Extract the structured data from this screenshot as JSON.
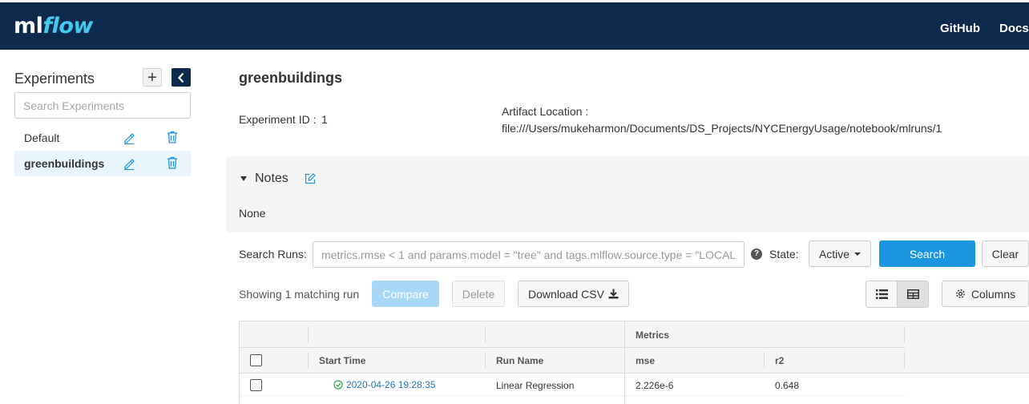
{
  "header": {
    "logo_ml": "ml",
    "logo_flow": "flow",
    "nav": [
      "GitHub",
      "Docs"
    ],
    "background": "#0d2a4d"
  },
  "sidebar": {
    "title": "Experiments",
    "add_label": "+",
    "search_placeholder": "Search Experiments",
    "experiments": [
      {
        "name": "Default",
        "active": false
      },
      {
        "name": "greenbuildings",
        "active": true
      }
    ]
  },
  "experiment": {
    "title": "greenbuildings",
    "id_label": "Experiment ID :",
    "id_value": "1",
    "artifact_label": "Artifact Location :",
    "artifact_value": "file:///Users/mukeharmon/Documents/DS_Projects/NYCEnergyUsage/notebook/mlruns/1"
  },
  "notes": {
    "title": "Notes",
    "body": "None"
  },
  "search": {
    "label": "Search Runs:",
    "placeholder": "metrics.rmse < 1 and params.model = \"tree\" and tags.mlflow.source.type = \"LOCAL",
    "help": "?",
    "state_label": "State:",
    "state_value": "Active",
    "search_button": "Search",
    "clear_button": "Clear"
  },
  "toolbar": {
    "showing": "Showing 1 matching run",
    "compare": "Compare",
    "delete": "Delete",
    "download": "Download CSV",
    "columns": "Columns"
  },
  "table": {
    "group_header": "Metrics",
    "columns": [
      "Start Time",
      "Run Name",
      "mse",
      "r2"
    ],
    "rows": [
      {
        "start_time": "2020-04-26 19:28:35",
        "run_name": "Linear Regression",
        "mse": "2.226e-6",
        "r2": "0.648",
        "status": "success"
      }
    ]
  },
  "colors": {
    "accent": "#1a95e0",
    "link": "#1f75b8",
    "success": "#2aa84a",
    "active_row": "#e8f5fb"
  },
  "icons": {
    "edit": "pencil-icon",
    "delete": "trash-icon",
    "collapse": "chevron-left-icon",
    "notes_edit": "edit-square-icon",
    "download": "download-icon",
    "list_view": "list-icon",
    "grid_view": "grid-icon",
    "columns": "gear-icon",
    "status": "check-circle-icon"
  }
}
